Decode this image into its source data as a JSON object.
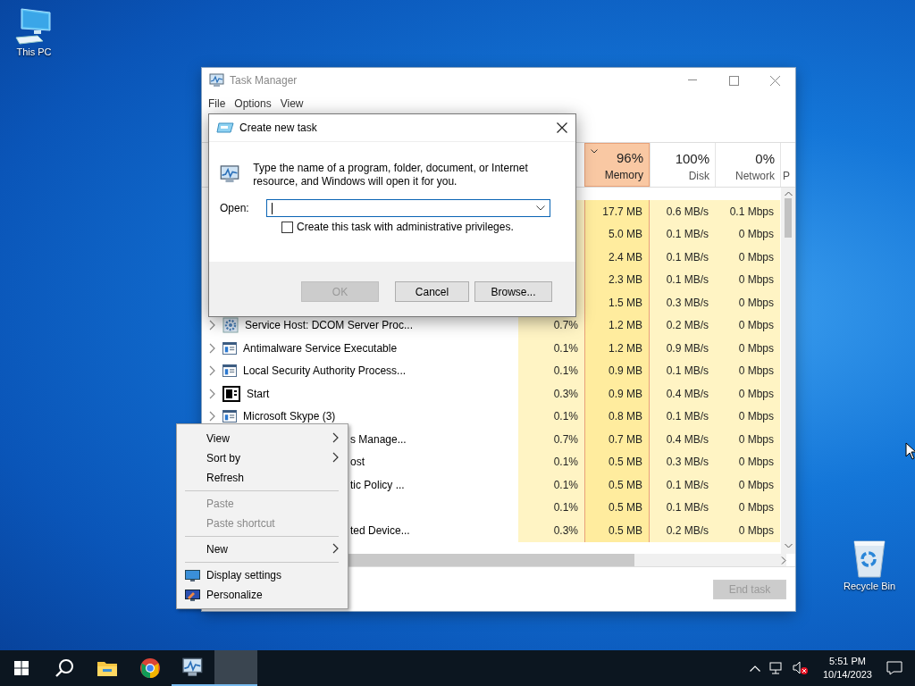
{
  "desktop_icons": [
    {
      "label": "This PC",
      "kind": "computer"
    },
    {
      "label": "Recycle Bin",
      "kind": "recycle"
    }
  ],
  "task_manager": {
    "title": "Task Manager",
    "menu": [
      "File",
      "Options",
      "View"
    ],
    "columns": [
      {
        "percent": "96%",
        "label": "Memory",
        "selected": true
      },
      {
        "percent": "100%",
        "label": "Disk",
        "selected": false
      },
      {
        "percent": "0%",
        "label": "Network",
        "selected": false
      },
      {
        "label": "P",
        "selected": false
      }
    ],
    "rows": [
      {
        "memory": "17.7 MB",
        "disk": "0.6 MB/s",
        "network": "0.1 Mbps"
      },
      {
        "memory": "5.0 MB",
        "disk": "0.1 MB/s",
        "network": "0 Mbps"
      },
      {
        "memory": "2.4 MB",
        "disk": "0.1 MB/s",
        "network": "0 Mbps"
      },
      {
        "memory": "2.3 MB",
        "disk": "0.1 MB/s",
        "network": "0 Mbps"
      },
      {
        "memory": "1.5 MB",
        "disk": "0.3 MB/s",
        "network": "0 Mbps"
      },
      {
        "name": "Service Host: DCOM Server Proc...",
        "kind": "service",
        "cpu": "0.7%",
        "memory": "1.2 MB",
        "disk": "0.2 MB/s",
        "network": "0 Mbps"
      },
      {
        "name": "Antimalware Service Executable",
        "kind": "app",
        "cpu": "0.1%",
        "memory": "1.2 MB",
        "disk": "0.9 MB/s",
        "network": "0 Mbps"
      },
      {
        "name": "Local Security Authority Process...",
        "kind": "app",
        "cpu": "0.1%",
        "memory": "0.9 MB",
        "disk": "0.1 MB/s",
        "network": "0 Mbps"
      },
      {
        "name": "Start",
        "kind": "start",
        "cpu": "0.3%",
        "memory": "0.9 MB",
        "disk": "0.4 MB/s",
        "network": "0 Mbps"
      },
      {
        "name": "Microsoft Skype (3)",
        "kind": "app",
        "cpu": "0.1%",
        "memory": "0.8 MB",
        "disk": "0.1 MB/s",
        "network": "0 Mbps"
      },
      {
        "name": "s Manage...",
        "kind": "fragment",
        "cpu": "0.7%",
        "memory": "0.7 MB",
        "disk": "0.4 MB/s",
        "network": "0 Mbps"
      },
      {
        "name": "ost",
        "kind": "fragment",
        "cpu": "0.1%",
        "memory": "0.5 MB",
        "disk": "0.3 MB/s",
        "network": "0 Mbps"
      },
      {
        "name": "tic Policy ...",
        "kind": "fragment",
        "cpu": "0.1%",
        "memory": "0.5 MB",
        "disk": "0.1 MB/s",
        "network": "0 Mbps"
      },
      {
        "cpu": "0.1%",
        "memory": "0.5 MB",
        "disk": "0.1 MB/s",
        "network": "0 Mbps"
      },
      {
        "name": "ted Device...",
        "kind": "fragment",
        "cpu": "0.3%",
        "memory": "0.5 MB",
        "disk": "0.2 MB/s",
        "network": "0 Mbps"
      }
    ],
    "end_task": {
      "label": "End task",
      "disabled": true
    }
  },
  "dialog": {
    "title": "Create new task",
    "message": "Type the name of a program, folder, document, or Internet resource, and Windows will open it for you.",
    "open_label": "Open:",
    "checkbox": {
      "label": "Create this task with administrative privileges.",
      "checked": false
    },
    "buttons": [
      {
        "label": "OK",
        "disabled": true
      },
      {
        "label": "Cancel",
        "disabled": false
      },
      {
        "label": "Browse...",
        "disabled": false
      }
    ]
  },
  "context_menu": [
    {
      "kind": "submenu",
      "label": "View",
      "disabled": false
    },
    {
      "kind": "submenu",
      "label": "Sort by",
      "disabled": false
    },
    {
      "kind": "item",
      "label": "Refresh",
      "disabled": false
    },
    {
      "kind": "separator"
    },
    {
      "kind": "item",
      "label": "Paste",
      "disabled": true
    },
    {
      "kind": "item",
      "label": "Paste shortcut",
      "disabled": true
    },
    {
      "kind": "separator"
    },
    {
      "kind": "submenu",
      "label": "New",
      "disabled": false
    },
    {
      "kind": "separator"
    },
    {
      "kind": "display",
      "label": "Display settings",
      "disabled": false
    },
    {
      "kind": "personalize",
      "label": "Personalize",
      "disabled": false
    }
  ],
  "taskbar": {
    "apps": [
      {
        "kind": "start",
        "running": false,
        "selected": false
      },
      {
        "kind": "search",
        "running": false,
        "selected": false
      },
      {
        "kind": "folder",
        "running": false,
        "selected": false
      },
      {
        "kind": "chrome",
        "running": false,
        "selected": false
      },
      {
        "kind": "taskmanager",
        "running": true,
        "selected": false
      },
      {
        "kind": "blank",
        "running": true,
        "selected": true
      }
    ],
    "time": "5:51 PM",
    "date": "10/14/2023"
  }
}
